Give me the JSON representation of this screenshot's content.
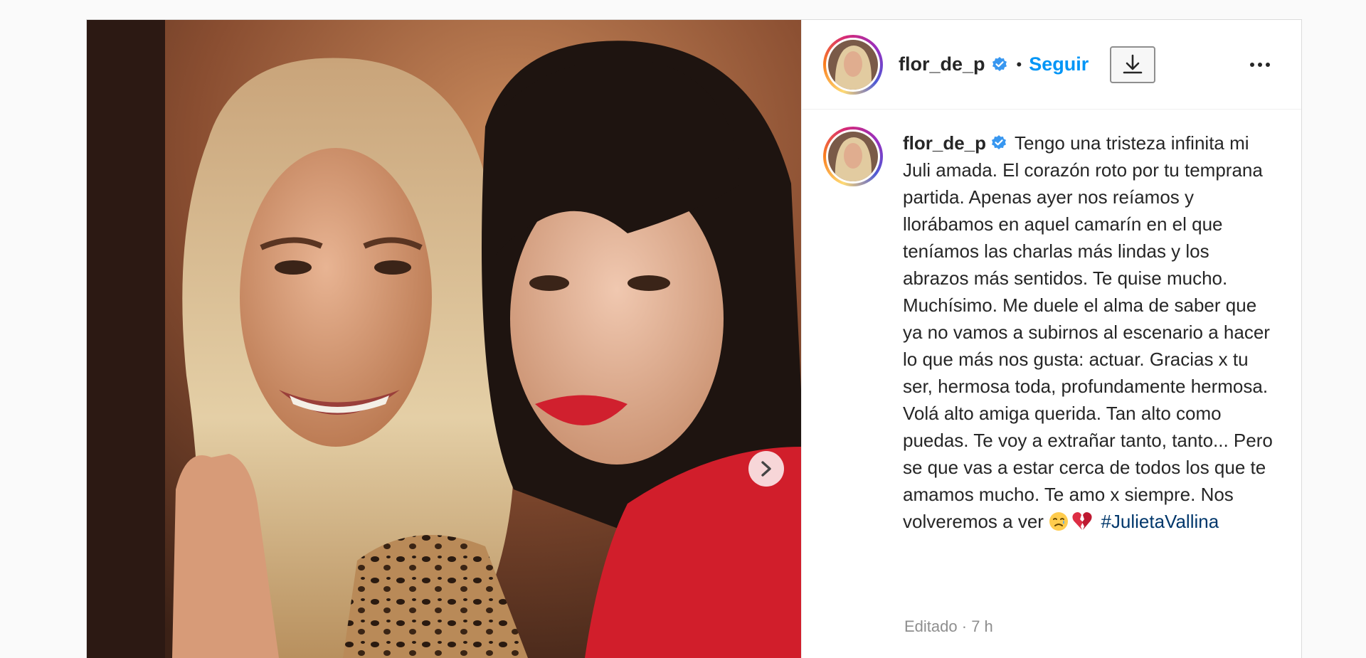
{
  "post": {
    "username": "flor_de_p",
    "follow_label": "Seguir",
    "separator": "•",
    "caption_text": "Tengo una tristeza infinita mi Juli amada. El corazón roto por tu temprana partida. Apenas ayer nos reíamos y llorábamos en aquel camarín en el que teníamos las charlas más lindas y los abrazos más sentidos. Te quise mucho. Muchísimo. Me duele el alma de saber que ya no vamos a subirnos al escenario a hacer lo que más nos gusta: actuar. Gracias x tu ser, hermosa toda, profundamente hermosa. Volá alto amiga querida. Tan alto como puedas. Te voy a extrañar tanto, tanto... Pero se que vas a estar cerca de todos los que te amamos mucho. Te amo x siempre. Nos volveremos a ver",
    "hashtag": "#JulietaVallina",
    "meta_edited": "Editado",
    "meta_dot": "·",
    "meta_time": "7 h"
  },
  "icons": {
    "verified": "verified-badge-icon",
    "download": "download-icon",
    "more": "more-options-icon",
    "next": "chevron-right-icon",
    "emoji_1": "sad-relieved-face-emoji",
    "emoji_2": "broken-heart-emoji"
  },
  "colors": {
    "accent": "#0095f6",
    "hashtag": "#00376b",
    "text": "#262626",
    "muted": "#8e8e8e"
  }
}
